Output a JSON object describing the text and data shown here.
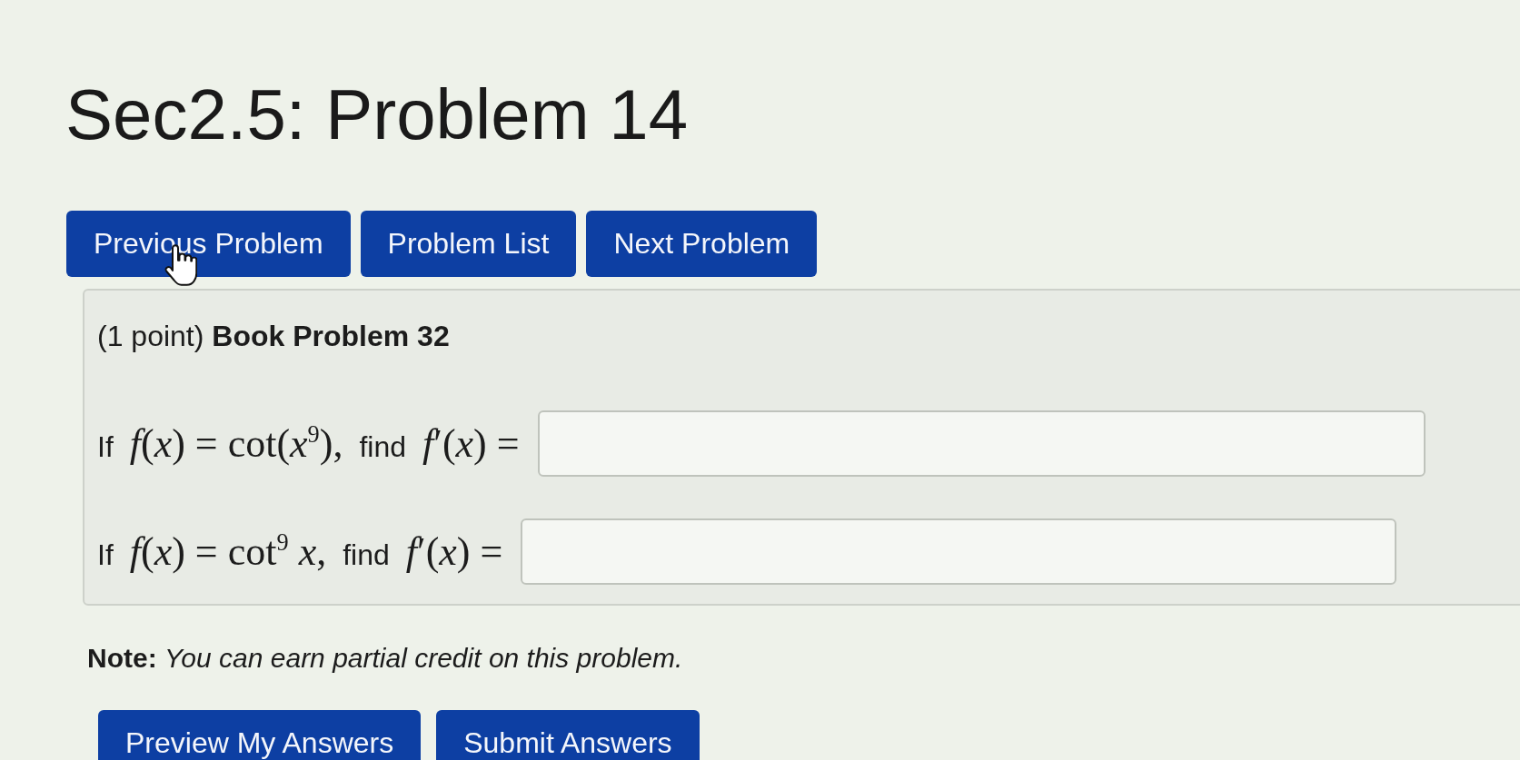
{
  "title": "Sec2.5: Problem 14",
  "nav_buttons": [
    {
      "label": "Previous Problem",
      "hovered": true
    },
    {
      "label": "Problem List",
      "hovered": false
    },
    {
      "label": "Next Problem",
      "hovered": false
    }
  ],
  "problem": {
    "heading": "(1 point) **Book Problem 32**",
    "questions": [
      {
        "parts": [
          {
            "kind": "text",
            "text": "If"
          },
          {
            "kind": "math",
            "text": "*f*(*x*) = cot(*x*$^{9}$),"
          },
          {
            "kind": "text",
            "text": "find"
          },
          {
            "kind": "math",
            "text": "*f*′(*x*) ="
          }
        ]
      },
      {
        "parts": [
          {
            "kind": "text",
            "text": "If"
          },
          {
            "kind": "math",
            "text": "*f*(*x*) = cot$^{9}$ *x*,"
          },
          {
            "kind": "text",
            "text": "find"
          },
          {
            "kind": "math",
            "text": "*f*′(*x*) ="
          }
        ]
      }
    ]
  },
  "note": "**Note:** *You can earn partial credit on this problem.*",
  "submit_buttons": [
    {
      "label": "Preview My Answers"
    },
    {
      "label": "Submit Answers"
    }
  ]
}
